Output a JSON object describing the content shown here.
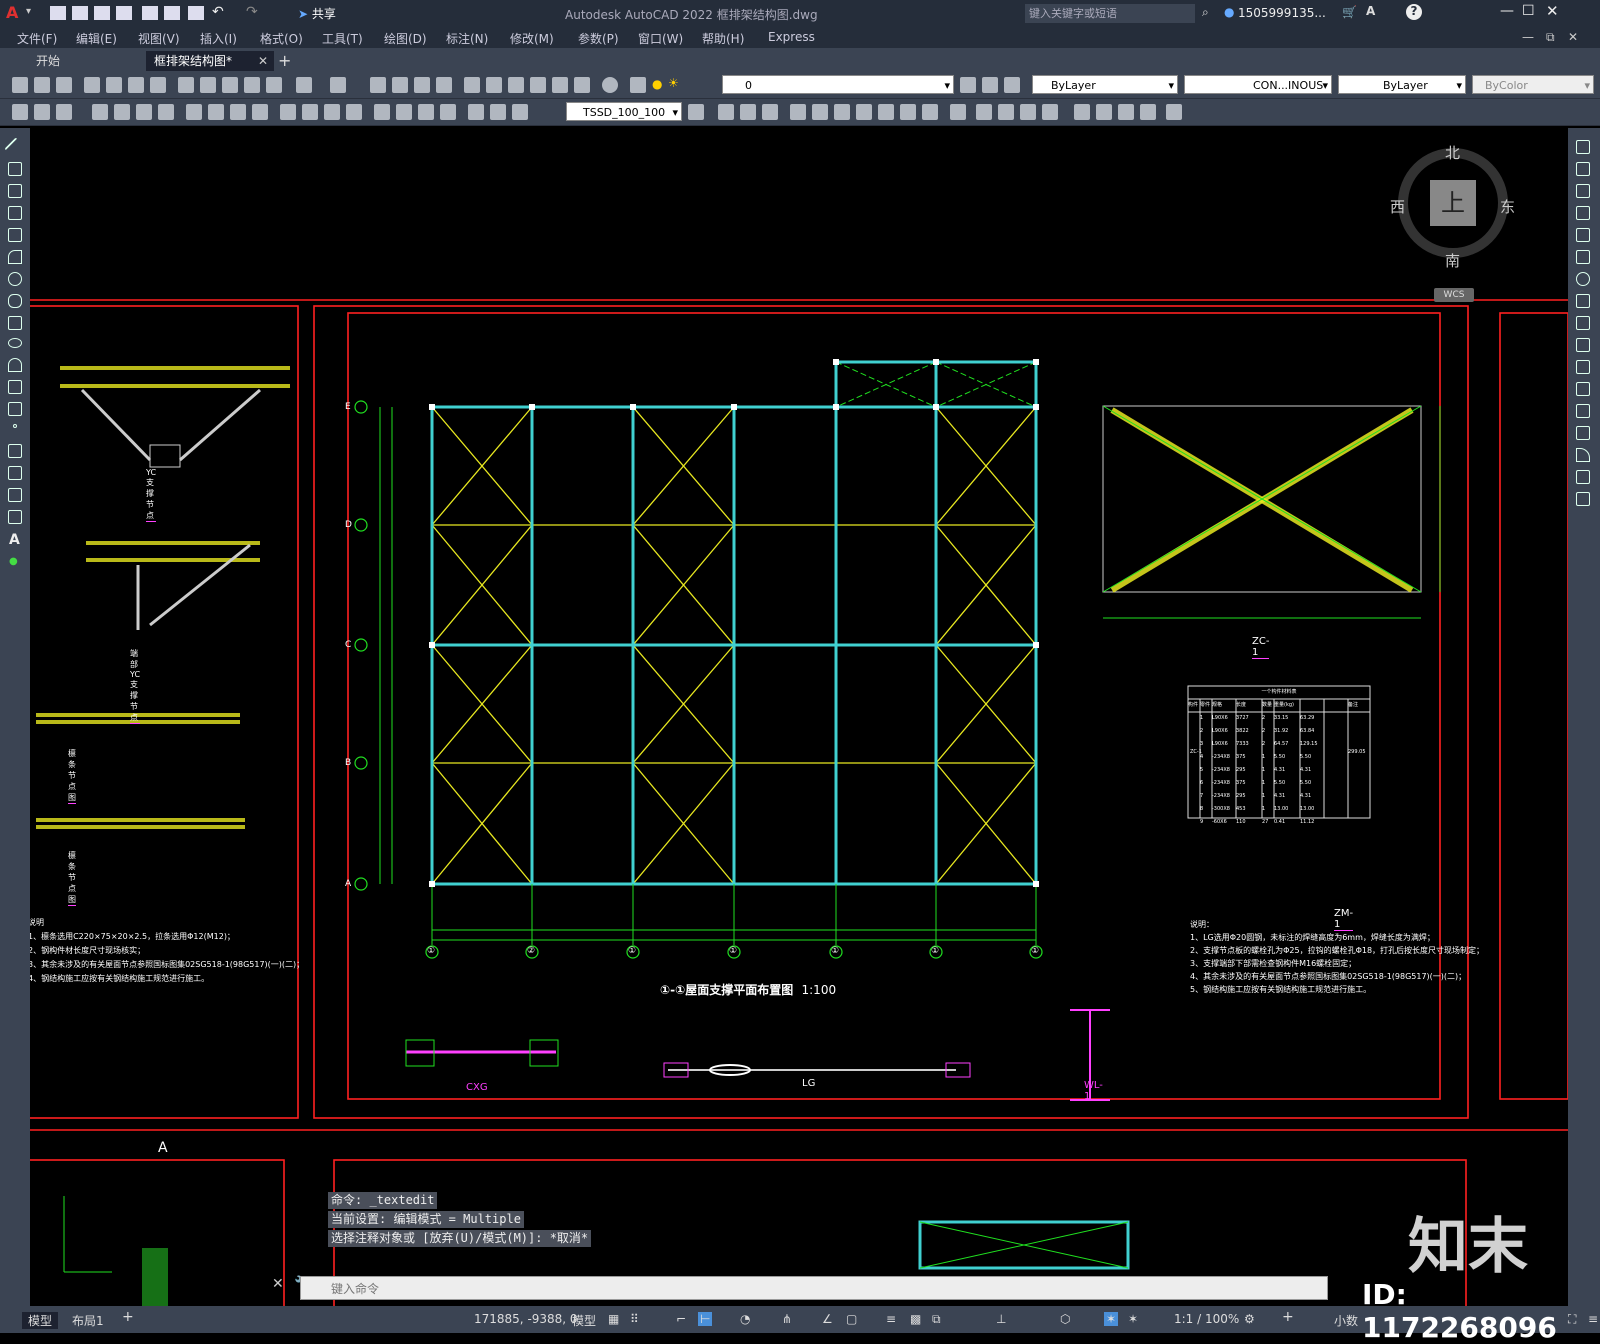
{
  "title_bar": {
    "title": "Autodesk AutoCAD 2022    框排架结构图.dwg",
    "share": "共享",
    "search_placeholder": "键入关键字或短语",
    "user": "1505999135...",
    "colors": {
      "bg": "#252d3a",
      "accent": "#e03030"
    }
  },
  "menu": [
    "文件(F)",
    "编辑(E)",
    "视图(V)",
    "插入(I)",
    "格式(O)",
    "工具(T)",
    "绘图(D)",
    "标注(N)",
    "修改(M)",
    "参数(P)",
    "窗口(W)",
    "帮助(H)",
    "Express"
  ],
  "tabs": [
    "开始",
    "框排架结构图*"
  ],
  "toolbar": {
    "layer": "0",
    "color": "ByLayer",
    "linetype": "CON...INOUS",
    "lineweight": "ByLayer",
    "plotstyle": "ByColor",
    "dimstyle": "TSSD_100_100"
  },
  "viewcube": {
    "north": "北",
    "south": "南",
    "east": "东",
    "west": "西",
    "face": "上",
    "wcs": "WCS"
  },
  "drawing": {
    "plan_title": "①-①屋面支撑平面布置图",
    "plan_scale": "1:100",
    "axes_left": [
      "E",
      "D",
      "C",
      "B",
      "A"
    ],
    "axes_bottom": [
      "①",
      "②",
      "①",
      "①",
      "①",
      "①",
      "①"
    ],
    "left_notes": [
      "说明",
      "1、檩条选用C220×75×20×2.5，拉条选用Φ12(M12)；",
      "2、钢构件材长度尺寸现场核实；",
      "3、其余未涉及的有关屋面节点参照国标图集02SG518-1(98G517)(一)(二)；",
      "4、钢结构施工应按有关钢结构施工规范进行施工。"
    ],
    "right_notes": [
      "说明：",
      "1、LG选用Φ20圆钢，未标注的焊缝高度为6mm，焊缝长度为满焊；",
      "2、支撑节点板的螺栓孔为Φ25，拉钩的螺栓孔Φ18，打孔后按长度尺寸现场制定；",
      "3、支撑端部下部需检查钢构件M16螺栓固定；",
      "4、其余未涉及的有关屋面节点参照国标图集02SG518-1(98G517)(一)(二)；",
      "5、钢结构施工应按有关钢结构施工规范进行施工。"
    ],
    "labels": {
      "yc": "YC支撑节点",
      "yc2": "端部YC支撑节点",
      "lt1": "檩条节点图",
      "lt2": "檩条节点图",
      "zc": "ZC-1",
      "zm": "ZM-1",
      "cxg": "CXG",
      "lg": "LG",
      "wl": "WL-1",
      "gridA": "A"
    },
    "colors": {
      "frame": "#ff2020",
      "column": "#40d0d0",
      "brace": "#e8e820",
      "dim": "#20e020",
      "text": "#ffffff",
      "magenta": "#ff40ff"
    }
  },
  "table": {
    "title": "一个构件材料表",
    "headers": [
      "构件",
      "零件",
      "规格",
      "长度",
      "数量",
      "重量(kg)",
      "",
      "备注"
    ],
    "rows": [
      [
        "1",
        "L90X6",
        "3727",
        "2",
        "33.15",
        "63.29"
      ],
      [
        "2",
        "L90X6",
        "3822",
        "2",
        "31.92",
        "63.84"
      ],
      [
        "3",
        "L90X6",
        "7333",
        "2",
        "64.57",
        "129.15"
      ],
      [
        "4",
        "-234X8",
        "375",
        "1",
        "5.50",
        "5.50"
      ],
      [
        "5",
        "-234X8",
        "295",
        "1",
        "4.31",
        "4.31"
      ],
      [
        "6",
        "-234X8",
        "375",
        "1",
        "5.50",
        "5.50"
      ],
      [
        "7",
        "-234X8",
        "295",
        "1",
        "4.31",
        "4.31"
      ],
      [
        "8",
        "-300X8",
        "453",
        "1",
        "13.00",
        "13.00"
      ],
      [
        "9",
        "-60X6",
        "110",
        "27",
        "0.41",
        "11.12"
      ]
    ],
    "member": "ZC-1",
    "total": "299.05"
  },
  "command": {
    "lines": [
      "命令: _textedit",
      "当前设置: 编辑模式 = Multiple",
      "选择注释对象或 [放弃(U)/模式(M)]: *取消*"
    ],
    "placeholder": "键入命令"
  },
  "status": {
    "layout_tabs": [
      "模型",
      "布局1"
    ],
    "coords": "171885, -9388, 0",
    "model": "模型",
    "scale": "1:1 / 100%",
    "units": "小数"
  },
  "watermark": {
    "brand": "知末",
    "id": "ID: 1172268096"
  }
}
